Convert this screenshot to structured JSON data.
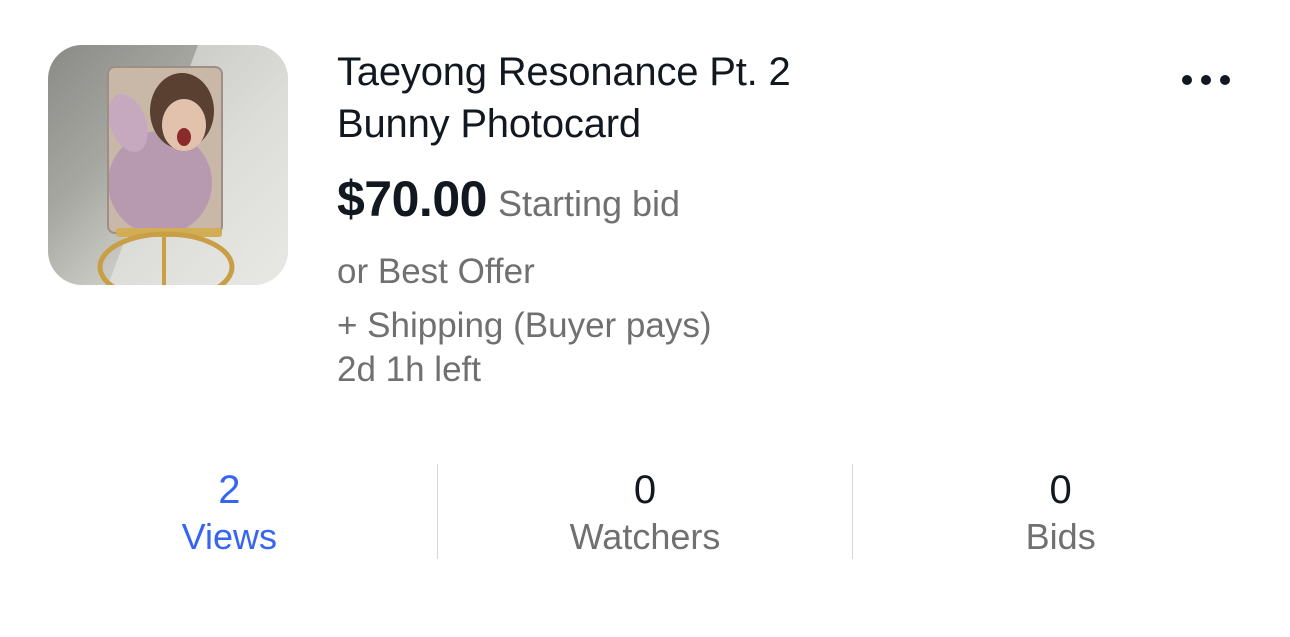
{
  "listing": {
    "title_line1": "Taeyong Resonance Pt. 2",
    "title_line2": "Bunny Photocard",
    "price": "$70.00",
    "price_type": "Starting bid",
    "best_offer": "or Best Offer",
    "shipping": "+ Shipping (Buyer pays)",
    "time_left": "2d 1h left",
    "thumbnail_icon": "photocard-image"
  },
  "menu": {
    "icon": "more-horizontal-icon"
  },
  "stats": [
    {
      "value": "2",
      "label": "Views",
      "active": true
    },
    {
      "value": "0",
      "label": "Watchers",
      "active": false
    },
    {
      "value": "0",
      "label": "Bids",
      "active": false
    }
  ],
  "colors": {
    "text_primary": "#111820",
    "text_secondary": "#707070",
    "link_blue": "#3665f3",
    "divider": "#d6d6d6"
  }
}
